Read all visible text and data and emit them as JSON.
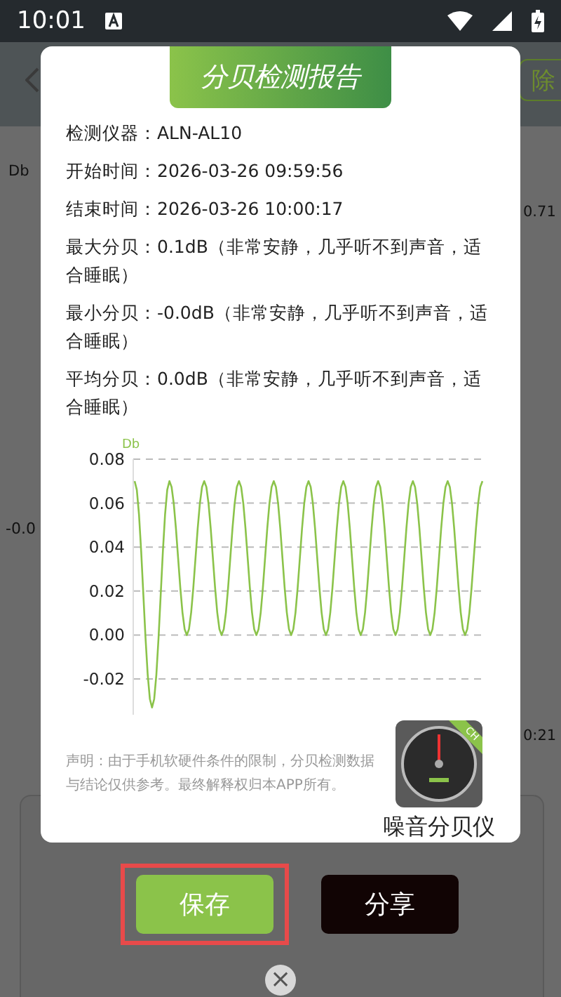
{
  "status_bar": {
    "time": "10:01"
  },
  "background": {
    "delete_button": "除",
    "axis_label": "Db",
    "peak_reading": "0.71",
    "left_tick": "-0.0",
    "time_reading": "0:21"
  },
  "dialog": {
    "title": "分贝检测报告",
    "fields": [
      {
        "label": "检测仪器：",
        "value": "ALN-AL10"
      },
      {
        "label": "开始时间：",
        "value": "2026-03-26 09:59:56"
      },
      {
        "label": "结束时间：",
        "value": "2026-03-26 10:00:17"
      },
      {
        "label": "最大分贝：",
        "value": "0.1dB（非常安静，几乎听不到声音，适合睡眠）"
      },
      {
        "label": "最小分贝：",
        "value": "-0.0dB（非常安静，几乎听不到声音，适合睡眠）"
      },
      {
        "label": "平均分贝：",
        "value": "0.0dB（非常安静，几乎听不到声音，适合睡眠）"
      }
    ],
    "chart_data": {
      "type": "line",
      "grid": true,
      "ylim": [
        -0.035,
        0.08
      ],
      "yticks": [
        {
          "value": 0.08,
          "label": "0.08"
        },
        {
          "value": 0.06,
          "label": "0.06"
        },
        {
          "value": 0.04,
          "label": "0.04"
        },
        {
          "value": 0.02,
          "label": "0.02"
        },
        {
          "value": 0,
          "label": "0.00"
        },
        {
          "value": -0.02,
          "label": "-0.02"
        }
      ],
      "series": [
        {
          "name": "Db",
          "color": "#8bc34a",
          "values": [
            0.07,
            -0.033,
            0.07,
            0,
            0.07,
            0,
            0.07,
            0,
            0.07,
            0,
            0.07,
            0,
            0.07,
            0,
            0.07,
            0,
            0.07,
            0,
            0.07,
            0,
            0.07
          ]
        }
      ]
    },
    "disclaimer": "声明：由于手机软硬件条件的限制，分贝检测数据与结论仅供参考。最终解释权归本APP所有。",
    "app_name": "噪音分贝仪",
    "app_badge": "CH"
  },
  "buttons": [
    {
      "label": "保存",
      "kind": "primary",
      "highlighted": true
    },
    {
      "label": "分享",
      "kind": "dark",
      "highlighted": false
    }
  ],
  "close": "×"
}
